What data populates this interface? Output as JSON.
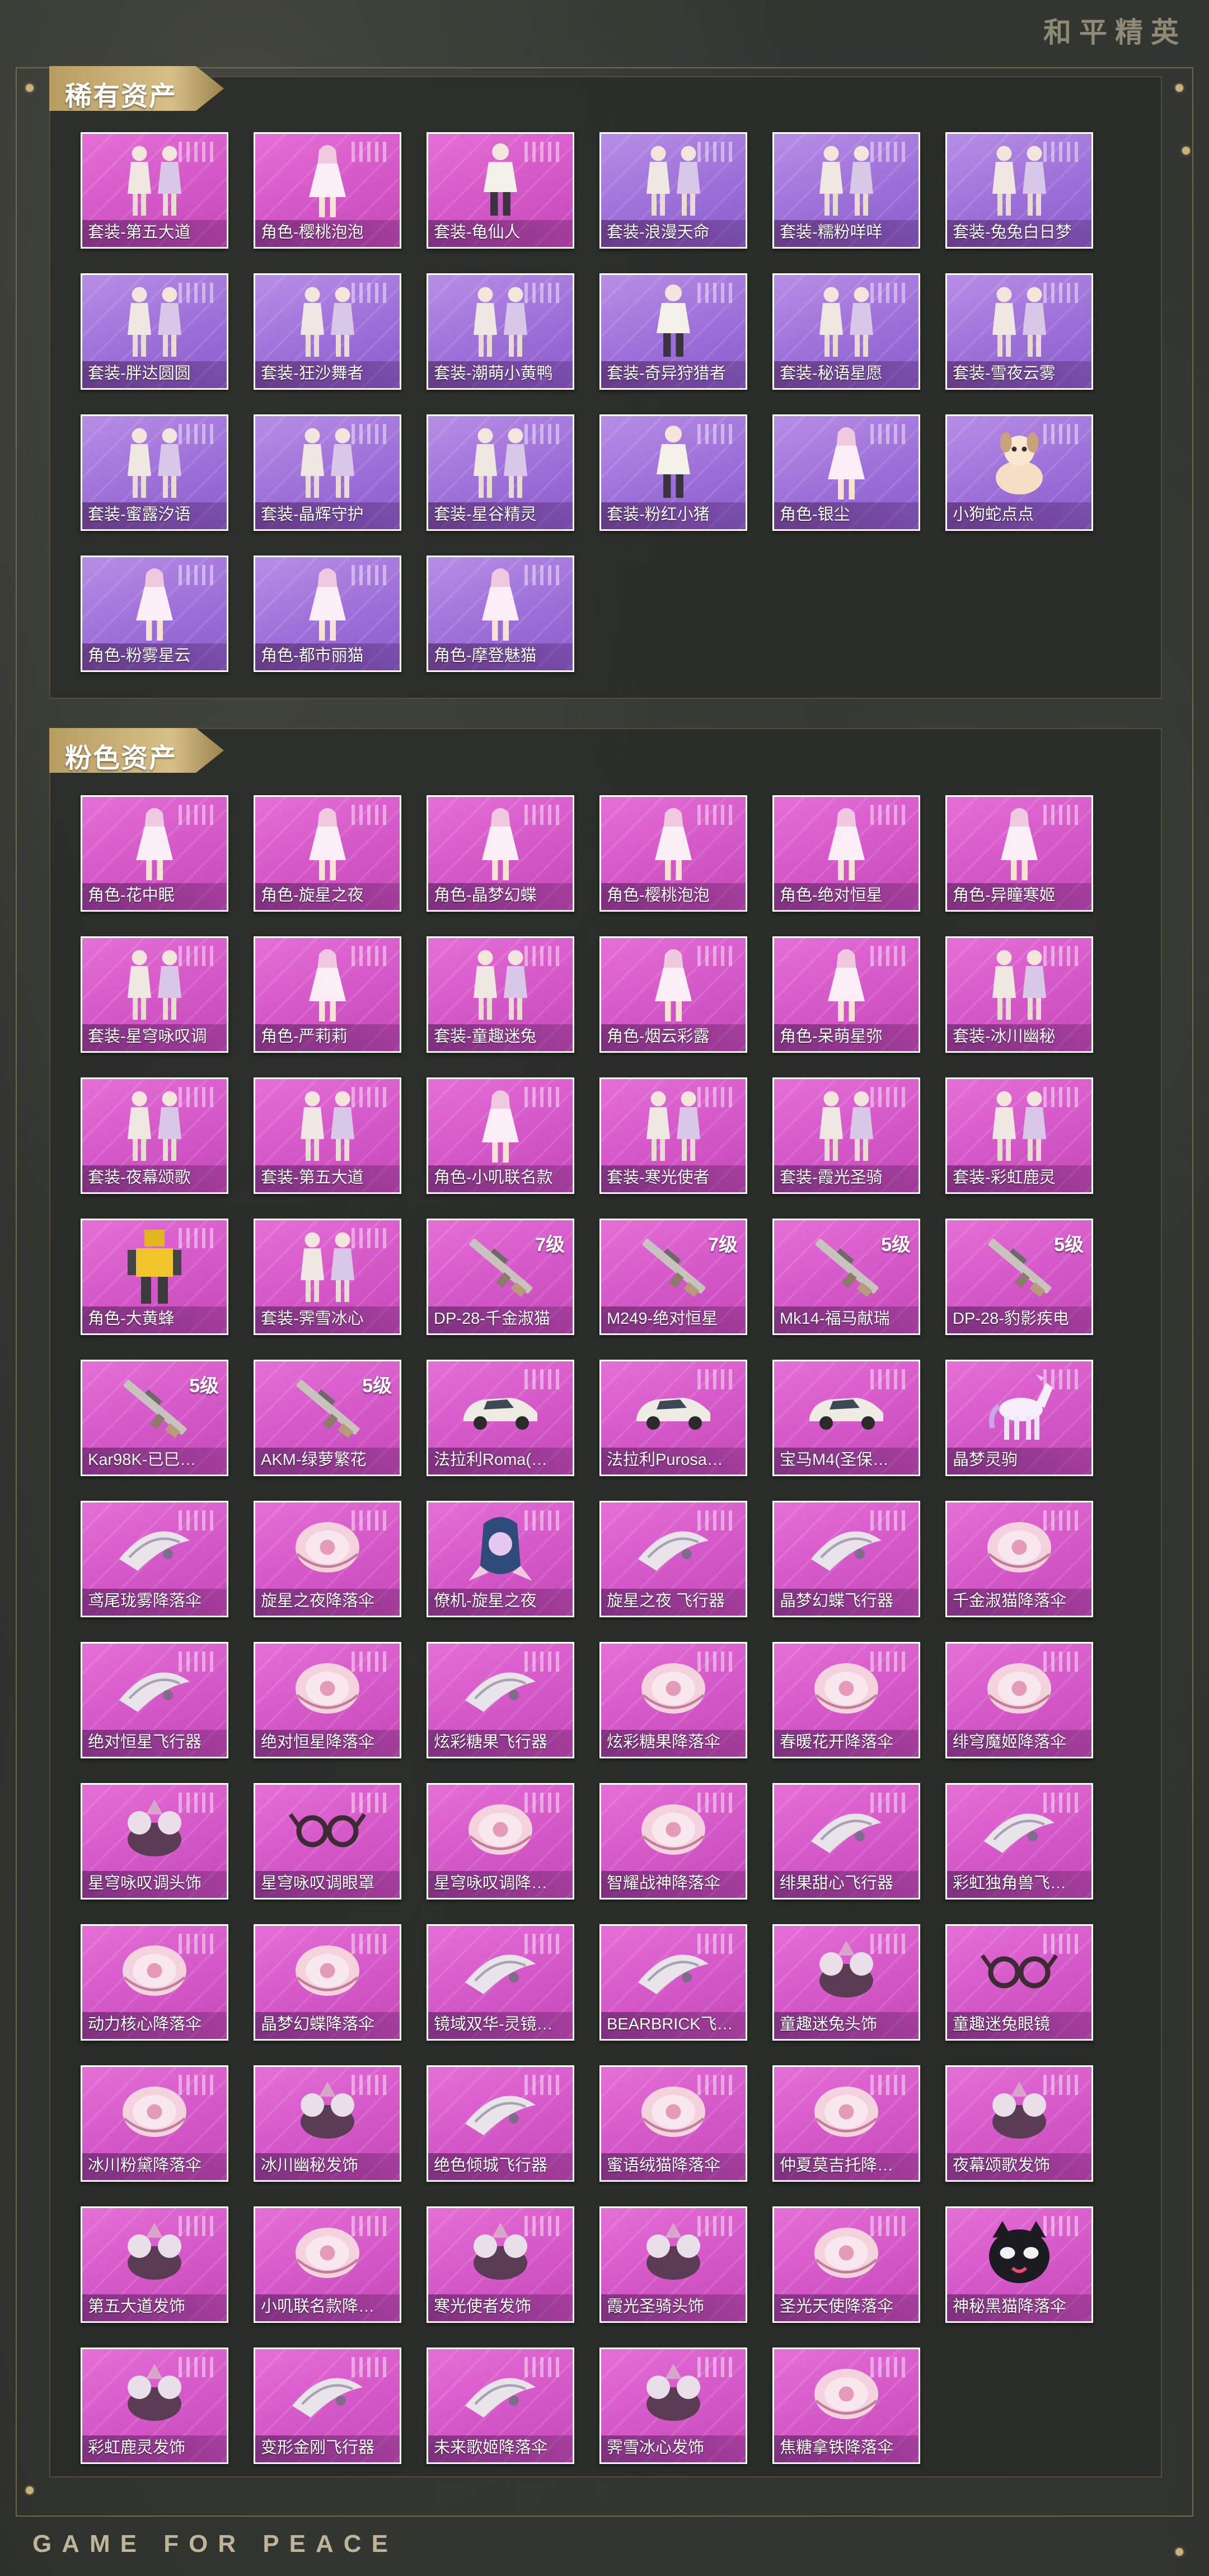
{
  "brand": "和平精英",
  "footer_brand": "GAME FOR PEACE",
  "colors": {
    "card_pink": "#d357c7",
    "card_purple": "#9d6fd8",
    "gold_banner": "#c8ad72"
  },
  "sections": [
    {
      "title": "稀有资产",
      "items": [
        {
          "label": "套装-第五大道",
          "tier": "pink",
          "icon": "outfit-pair-icon",
          "level": ""
        },
        {
          "label": "角色-樱桃泡泡",
          "tier": "pink",
          "icon": "character-figure-icon",
          "level": ""
        },
        {
          "label": "套装-龟仙人",
          "tier": "pink",
          "icon": "outfit-figure-icon",
          "level": ""
        },
        {
          "label": "套装-浪漫天命",
          "tier": "purple",
          "icon": "outfit-pair-icon",
          "level": ""
        },
        {
          "label": "套装-糯粉咩咩",
          "tier": "purple",
          "icon": "outfit-pair-icon",
          "level": ""
        },
        {
          "label": "套装-兔兔白日梦",
          "tier": "purple",
          "icon": "outfit-pair-icon",
          "level": ""
        },
        {
          "label": "套装-胖达圆圆",
          "tier": "purple",
          "icon": "outfit-pair-icon",
          "level": ""
        },
        {
          "label": "套装-狂沙舞者",
          "tier": "purple",
          "icon": "outfit-pair-icon",
          "level": ""
        },
        {
          "label": "套装-潮萌小黄鸭",
          "tier": "purple",
          "icon": "outfit-pair-icon",
          "level": ""
        },
        {
          "label": "套装-奇异狩猎者",
          "tier": "purple",
          "icon": "outfit-figure-icon",
          "level": ""
        },
        {
          "label": "套装-秘语星愿",
          "tier": "purple",
          "icon": "outfit-pair-icon",
          "level": ""
        },
        {
          "label": "套装-雪夜云雾",
          "tier": "purple",
          "icon": "outfit-pair-icon",
          "level": ""
        },
        {
          "label": "套装-蜜露汐语",
          "tier": "purple",
          "icon": "outfit-pair-icon",
          "level": ""
        },
        {
          "label": "套装-晶辉守护",
          "tier": "purple",
          "icon": "outfit-pair-icon",
          "level": ""
        },
        {
          "label": "套装-星谷精灵",
          "tier": "purple",
          "icon": "outfit-pair-icon",
          "level": ""
        },
        {
          "label": "套装-粉红小猪",
          "tier": "purple",
          "icon": "outfit-figure-icon",
          "level": ""
        },
        {
          "label": "角色-银尘",
          "tier": "purple",
          "icon": "character-figure-icon",
          "level": ""
        },
        {
          "label": "小狗蛇点点",
          "tier": "purple",
          "icon": "pet-icon",
          "level": ""
        },
        {
          "label": "角色-粉雾星云",
          "tier": "purple",
          "icon": "character-figure-icon",
          "level": ""
        },
        {
          "label": "角色-都市丽猫",
          "tier": "purple",
          "icon": "character-figure-icon",
          "level": ""
        },
        {
          "label": "角色-摩登魅猫",
          "tier": "purple",
          "icon": "character-figure-icon",
          "level": ""
        }
      ]
    },
    {
      "title": "粉色资产",
      "items": [
        {
          "label": "角色-花中眠",
          "tier": "pink",
          "icon": "character-figure-icon",
          "level": ""
        },
        {
          "label": "角色-旋星之夜",
          "tier": "pink",
          "icon": "character-figure-icon",
          "level": ""
        },
        {
          "label": "角色-晶梦幻蝶",
          "tier": "pink",
          "icon": "character-figure-icon",
          "level": ""
        },
        {
          "label": "角色-樱桃泡泡",
          "tier": "pink",
          "icon": "character-figure-icon",
          "level": ""
        },
        {
          "label": "角色-绝对恒星",
          "tier": "pink",
          "icon": "character-figure-icon",
          "level": ""
        },
        {
          "label": "角色-异瞳寒姬",
          "tier": "pink",
          "icon": "character-figure-icon",
          "level": ""
        },
        {
          "label": "套装-星穹咏叹调",
          "tier": "pink",
          "icon": "outfit-pair-icon",
          "level": ""
        },
        {
          "label": "角色-严莉莉",
          "tier": "pink",
          "icon": "character-figure-icon",
          "level": ""
        },
        {
          "label": "套装-童趣迷兔",
          "tier": "pink",
          "icon": "outfit-pair-icon",
          "level": ""
        },
        {
          "label": "角色-烟云彩露",
          "tier": "pink",
          "icon": "character-figure-icon",
          "level": ""
        },
        {
          "label": "角色-呆萌星弥",
          "tier": "pink",
          "icon": "character-figure-icon",
          "level": ""
        },
        {
          "label": "套装-冰川幽秘",
          "tier": "pink",
          "icon": "outfit-pair-icon",
          "level": ""
        },
        {
          "label": "套装-夜幕颂歌",
          "tier": "pink",
          "icon": "outfit-pair-icon",
          "level": ""
        },
        {
          "label": "套装-第五大道",
          "tier": "pink",
          "icon": "outfit-pair-icon",
          "level": ""
        },
        {
          "label": "角色-小叽联名款",
          "tier": "pink",
          "icon": "character-figure-icon",
          "level": ""
        },
        {
          "label": "套装-寒光使者",
          "tier": "pink",
          "icon": "outfit-pair-icon",
          "level": ""
        },
        {
          "label": "套装-霞光圣骑",
          "tier": "pink",
          "icon": "outfit-pair-icon",
          "level": ""
        },
        {
          "label": "套装-彩虹鹿灵",
          "tier": "pink",
          "icon": "outfit-pair-icon",
          "level": ""
        },
        {
          "label": "角色-大黄蜂",
          "tier": "pink",
          "icon": "mech-figure-icon",
          "level": ""
        },
        {
          "label": "套装-霁雪冰心",
          "tier": "pink",
          "icon": "outfit-pair-icon",
          "level": ""
        },
        {
          "label": "DP-28-千金淑猫",
          "tier": "pink",
          "icon": "gun-icon",
          "level": "7级"
        },
        {
          "label": "M249-绝对恒星",
          "tier": "pink",
          "icon": "gun-icon",
          "level": "7级"
        },
        {
          "label": "Mk14-福马献瑞",
          "tier": "pink",
          "icon": "gun-icon",
          "level": "5级"
        },
        {
          "label": "DP-28-豹影疾电",
          "tier": "pink",
          "icon": "gun-icon",
          "level": "5级"
        },
        {
          "label": "Kar98K-已巳…",
          "tier": "pink",
          "icon": "gun-icon",
          "level": "5级"
        },
        {
          "label": "AKM-绿萝繁花",
          "tier": "pink",
          "icon": "gun-icon",
          "level": "5级"
        },
        {
          "label": "法拉利Roma(…",
          "tier": "pink",
          "icon": "car-icon",
          "level": ""
        },
        {
          "label": "法拉利Purosa…",
          "tier": "pink",
          "icon": "car-icon",
          "level": ""
        },
        {
          "label": "宝马M4(圣保…",
          "tier": "pink",
          "icon": "car-icon",
          "level": ""
        },
        {
          "label": "晶梦灵驹",
          "tier": "pink",
          "icon": "horse-icon",
          "level": ""
        },
        {
          "label": "鸢尾珑雾降落伞",
          "tier": "pink",
          "icon": "glider-icon",
          "level": ""
        },
        {
          "label": "旋星之夜降落伞",
          "tier": "pink",
          "icon": "parachute-icon",
          "level": ""
        },
        {
          "label": "僚机-旋星之夜",
          "tier": "pink",
          "icon": "wingman-icon",
          "level": ""
        },
        {
          "label": "旋星之夜 飞行器",
          "tier": "pink",
          "icon": "glider-icon",
          "level": ""
        },
        {
          "label": "晶梦幻蝶飞行器",
          "tier": "pink",
          "icon": "glider-icon",
          "level": ""
        },
        {
          "label": "千金淑猫降落伞",
          "tier": "pink",
          "icon": "parachute-icon",
          "level": ""
        },
        {
          "label": "绝对恒星飞行器",
          "tier": "pink",
          "icon": "glider-icon",
          "level": ""
        },
        {
          "label": "绝对恒星降落伞",
          "tier": "pink",
          "icon": "parachute-icon",
          "level": ""
        },
        {
          "label": "炫彩糖果飞行器",
          "tier": "pink",
          "icon": "glider-icon",
          "level": ""
        },
        {
          "label": "炫彩糖果降落伞",
          "tier": "pink",
          "icon": "parachute-icon",
          "level": ""
        },
        {
          "label": "春暖花开降落伞",
          "tier": "pink",
          "icon": "parachute-icon",
          "level": ""
        },
        {
          "label": "绯穹魔姬降落伞",
          "tier": "pink",
          "icon": "parachute-icon",
          "level": ""
        },
        {
          "label": "星穹咏叹调头饰",
          "tier": "pink",
          "icon": "headwear-icon",
          "level": ""
        },
        {
          "label": "星穹咏叹调眼罩",
          "tier": "pink",
          "icon": "eyewear-icon",
          "level": ""
        },
        {
          "label": "星穹咏叹调降…",
          "tier": "pink",
          "icon": "parachute-icon",
          "level": ""
        },
        {
          "label": "智耀战神降落伞",
          "tier": "pink",
          "icon": "parachute-icon",
          "level": ""
        },
        {
          "label": "绯果甜心飞行器",
          "tier": "pink",
          "icon": "glider-icon",
          "level": ""
        },
        {
          "label": "彩虹独角兽飞…",
          "tier": "pink",
          "icon": "glider-icon",
          "level": ""
        },
        {
          "label": "动力核心降落伞",
          "tier": "pink",
          "icon": "parachute-icon",
          "level": ""
        },
        {
          "label": "晶梦幻蝶降落伞",
          "tier": "pink",
          "icon": "parachute-icon",
          "level": ""
        },
        {
          "label": "镜域双华-灵镜…",
          "tier": "pink",
          "icon": "glider-icon",
          "level": ""
        },
        {
          "label": "BEARBRICK飞…",
          "tier": "pink",
          "icon": "glider-icon",
          "level": ""
        },
        {
          "label": "童趣迷兔头饰",
          "tier": "pink",
          "icon": "headwear-icon",
          "level": ""
        },
        {
          "label": "童趣迷兔眼镜",
          "tier": "pink",
          "icon": "eyewear-icon",
          "level": ""
        },
        {
          "label": "冰川粉黛降落伞",
          "tier": "pink",
          "icon": "parachute-icon",
          "level": ""
        },
        {
          "label": "冰川幽秘发饰",
          "tier": "pink",
          "icon": "headwear-icon",
          "level": ""
        },
        {
          "label": "绝色倾城飞行器",
          "tier": "pink",
          "icon": "glider-icon",
          "level": ""
        },
        {
          "label": "蜜语绒猫降落伞",
          "tier": "pink",
          "icon": "parachute-icon",
          "level": ""
        },
        {
          "label": "仲夏莫吉托降…",
          "tier": "pink",
          "icon": "parachute-icon",
          "level": ""
        },
        {
          "label": "夜幕颂歌发饰",
          "tier": "pink",
          "icon": "headwear-icon",
          "level": ""
        },
        {
          "label": "第五大道发饰",
          "tier": "pink",
          "icon": "headwear-icon",
          "level": ""
        },
        {
          "label": "小叽联名款降…",
          "tier": "pink",
          "icon": "parachute-icon",
          "level": ""
        },
        {
          "label": "寒光使者发饰",
          "tier": "pink",
          "icon": "headwear-icon",
          "level": ""
        },
        {
          "label": "霞光圣骑头饰",
          "tier": "pink",
          "icon": "headwear-icon",
          "level": ""
        },
        {
          "label": "圣光天使降落伞",
          "tier": "pink",
          "icon": "parachute-icon",
          "level": ""
        },
        {
          "label": "神秘黑猫降落伞",
          "tier": "pink",
          "icon": "cat-parachute-icon",
          "level": ""
        },
        {
          "label": "彩虹鹿灵发饰",
          "tier": "pink",
          "icon": "headwear-icon",
          "level": ""
        },
        {
          "label": "变形金刚飞行器",
          "tier": "pink",
          "icon": "glider-icon",
          "level": ""
        },
        {
          "label": "未来歌姬降落伞",
          "tier": "pink",
          "icon": "glider-icon",
          "level": ""
        },
        {
          "label": "霁雪冰心发饰",
          "tier": "pink",
          "icon": "headwear-icon",
          "level": ""
        },
        {
          "label": "焦糖拿铁降落伞",
          "tier": "pink",
          "icon": "parachute-icon",
          "level": ""
        }
      ]
    }
  ]
}
